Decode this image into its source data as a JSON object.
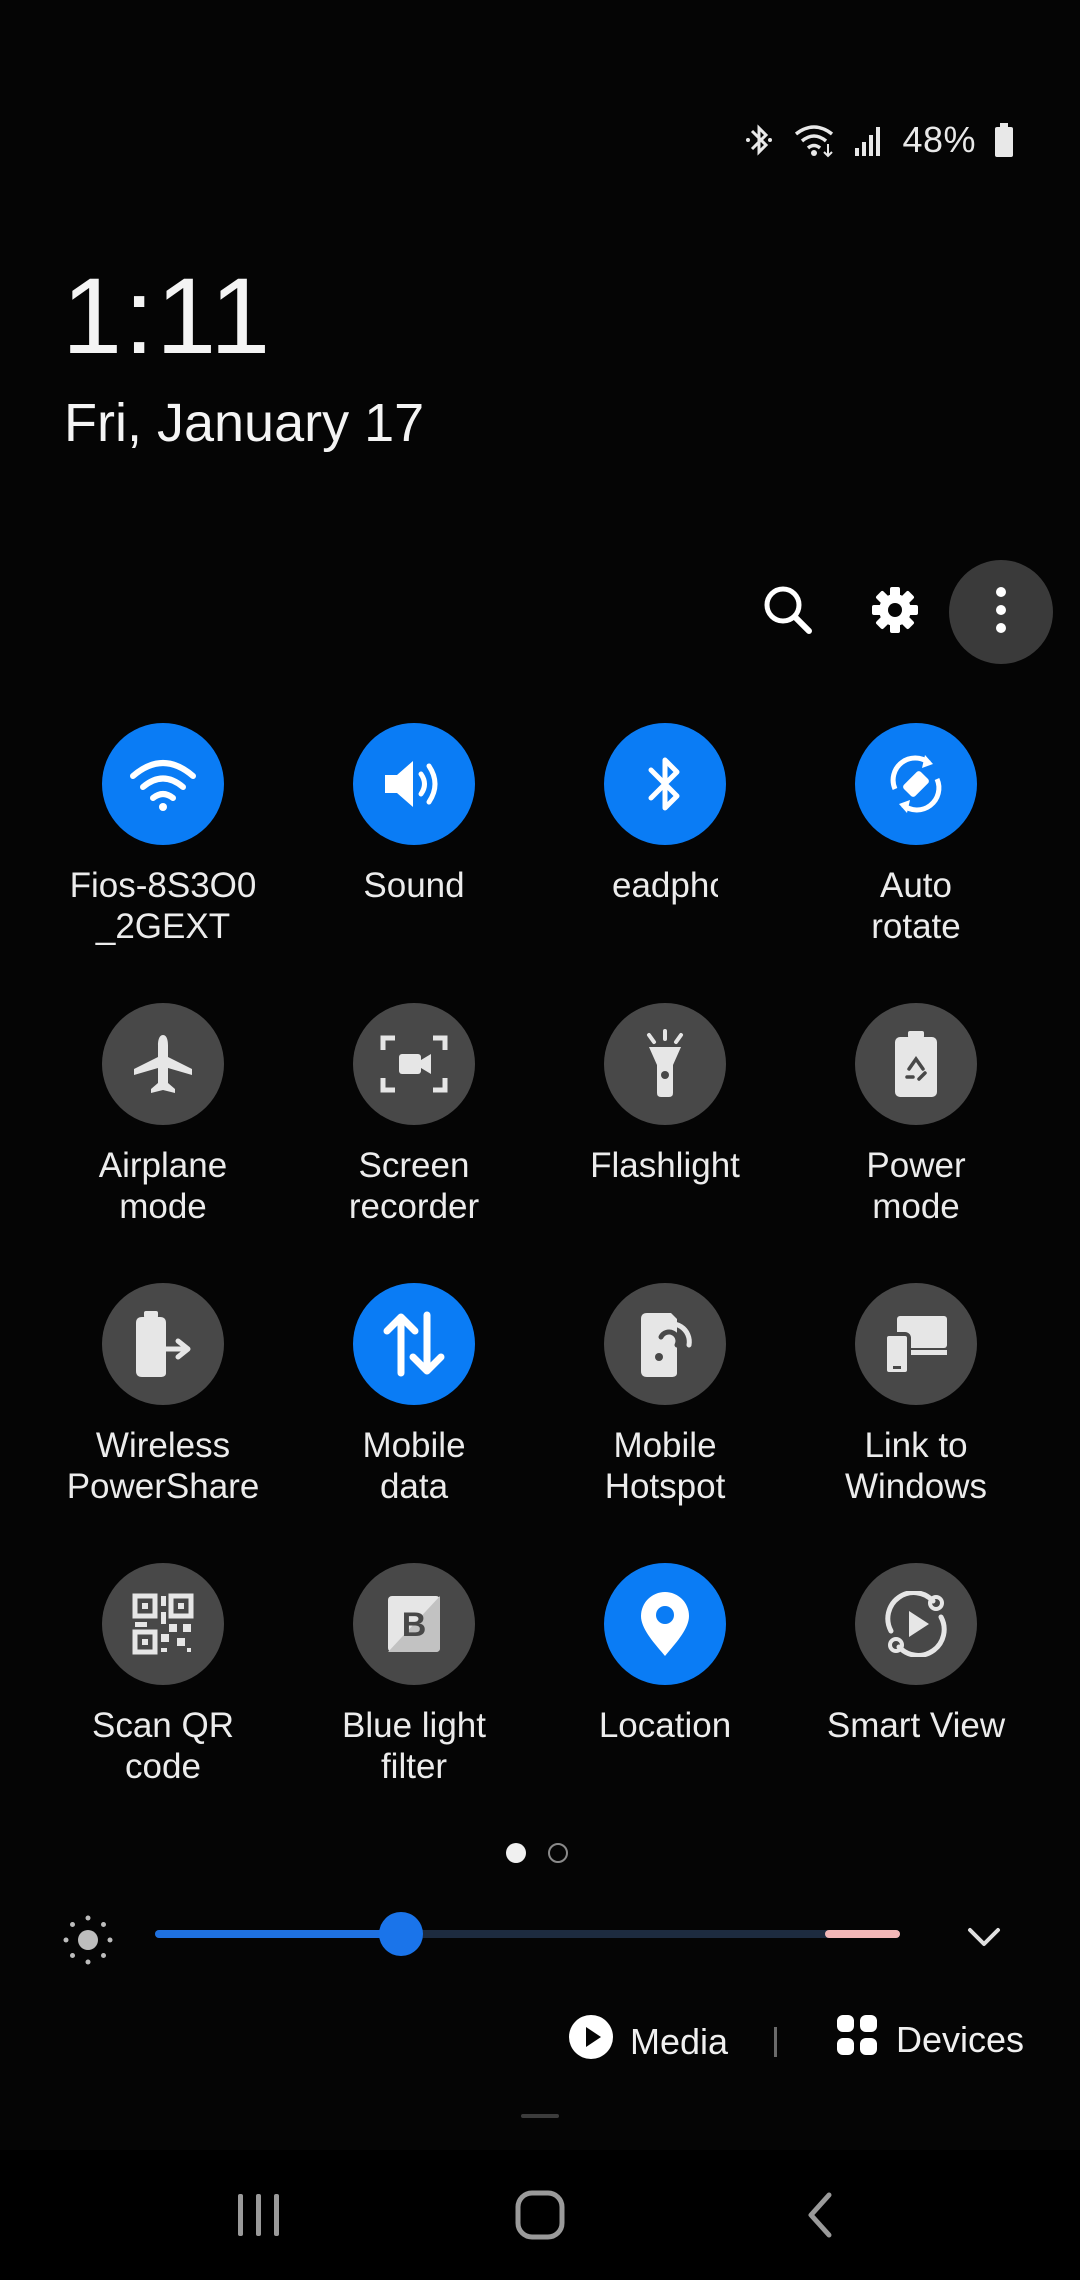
{
  "status_bar": {
    "icons": [
      "bluetooth-icon",
      "wifi-icon",
      "cellular-signal-icon",
      "battery-icon"
    ],
    "battery_percent": "48%"
  },
  "clock": {
    "time": "1:11",
    "date": "Fri, January 17"
  },
  "top_actions": [
    "search-icon",
    "gear-icon",
    "more-vert-icon"
  ],
  "tiles": [
    {
      "label": "Fios-8S3O0\n_2GEXT",
      "icon": "wifi-icon",
      "active": true
    },
    {
      "label": "Sound",
      "icon": "volume-icon",
      "active": true
    },
    {
      "label": "eadphone] G",
      "icon": "bluetooth-icon",
      "active": true
    },
    {
      "label": "Auto\nrotate",
      "icon": "auto-rotate-icon",
      "active": true
    },
    {
      "label": "Airplane\nmode",
      "icon": "airplane-icon",
      "active": false
    },
    {
      "label": "Screen\nrecorder",
      "icon": "screen-recorder-icon",
      "active": false
    },
    {
      "label": "Flashlight",
      "icon": "flashlight-icon",
      "active": false
    },
    {
      "label": "Power\nmode",
      "icon": "power-mode-icon",
      "active": false
    },
    {
      "label": "Wireless\nPowerShare",
      "icon": "wireless-powershare-icon",
      "active": false
    },
    {
      "label": "Mobile\ndata",
      "icon": "mobile-data-icon",
      "active": true
    },
    {
      "label": "Mobile\nHotspot",
      "icon": "hotspot-icon",
      "active": false
    },
    {
      "label": "Link to\nWindows",
      "icon": "link-to-windows-icon",
      "active": false
    },
    {
      "label": "Scan QR\ncode",
      "icon": "qr-code-icon",
      "active": false
    },
    {
      "label": "Blue light\nfilter",
      "icon": "blue-light-filter-icon",
      "active": false
    },
    {
      "label": "Location",
      "icon": "location-icon",
      "active": true
    },
    {
      "label": "Smart View",
      "icon": "smart-view-icon",
      "active": false
    }
  ],
  "page_indicator": {
    "current": 1,
    "total": 2
  },
  "brightness": {
    "level": 0.33,
    "icon": "brightness-icon"
  },
  "media": {
    "label": "Media",
    "icon": "play-icon"
  },
  "devices": {
    "label": "Devices",
    "icon": "devices-grid-icon"
  },
  "nav_bar": [
    "recents-icon",
    "home-icon",
    "back-icon"
  ],
  "colors": {
    "accent": "#0a7cf5",
    "tile_off": "#484848",
    "background": "#050505"
  }
}
